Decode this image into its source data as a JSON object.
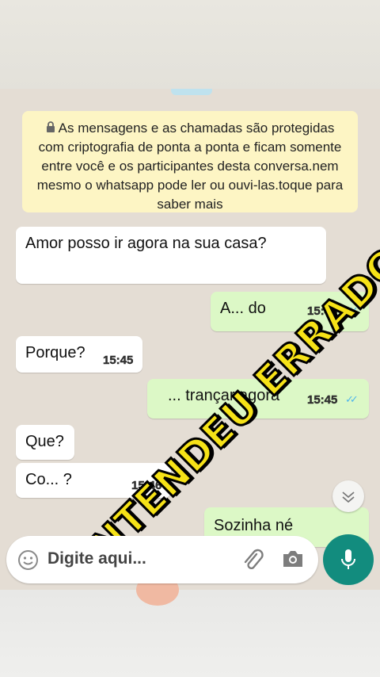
{
  "encryption_notice": "As mensagens e as chamadas são protegidas com criptografia de ponta a ponta e ficam somente entre você e os participantes desta conversa.nem mesmo o whatsapp pode ler ou ouvi-las.toque para saber mais",
  "messages": [
    {
      "direction": "in",
      "text": "Amor posso ir agora na sua casa?",
      "time": ""
    },
    {
      "direction": "out",
      "text": "A... do",
      "time": "15:45",
      "ticks": "✓✓"
    },
    {
      "direction": "in",
      "text": "Porque?",
      "time": "15:45"
    },
    {
      "direction": "out",
      "text": "... trançar agora",
      "time": "15:45",
      "ticks": "✓✓"
    },
    {
      "direction": "in",
      "text": "Que?",
      "time": ""
    },
    {
      "direction": "in",
      "text": "Co... ?",
      "time": "15:46"
    },
    {
      "direction": "out",
      "text": "Sozinha né",
      "time": "",
      "ticks": "✓✓"
    }
  ],
  "overlay_caption": "ENTENDEU ERRADO",
  "input": {
    "placeholder": "Digite aqui..."
  },
  "icons": {
    "emoji": "emoji-icon",
    "attach": "paperclip-icon",
    "camera": "camera-icon",
    "mic": "mic-icon",
    "scroll": "chevron-down-icon",
    "lock": "lock-icon"
  },
  "colors": {
    "incoming": "#ffffff",
    "outgoing": "#dcf8c6",
    "notice": "#fdf5c4",
    "accent": "#128c7e",
    "read_ticks": "#4fb6ec",
    "overlay_text": "#f6e217"
  }
}
